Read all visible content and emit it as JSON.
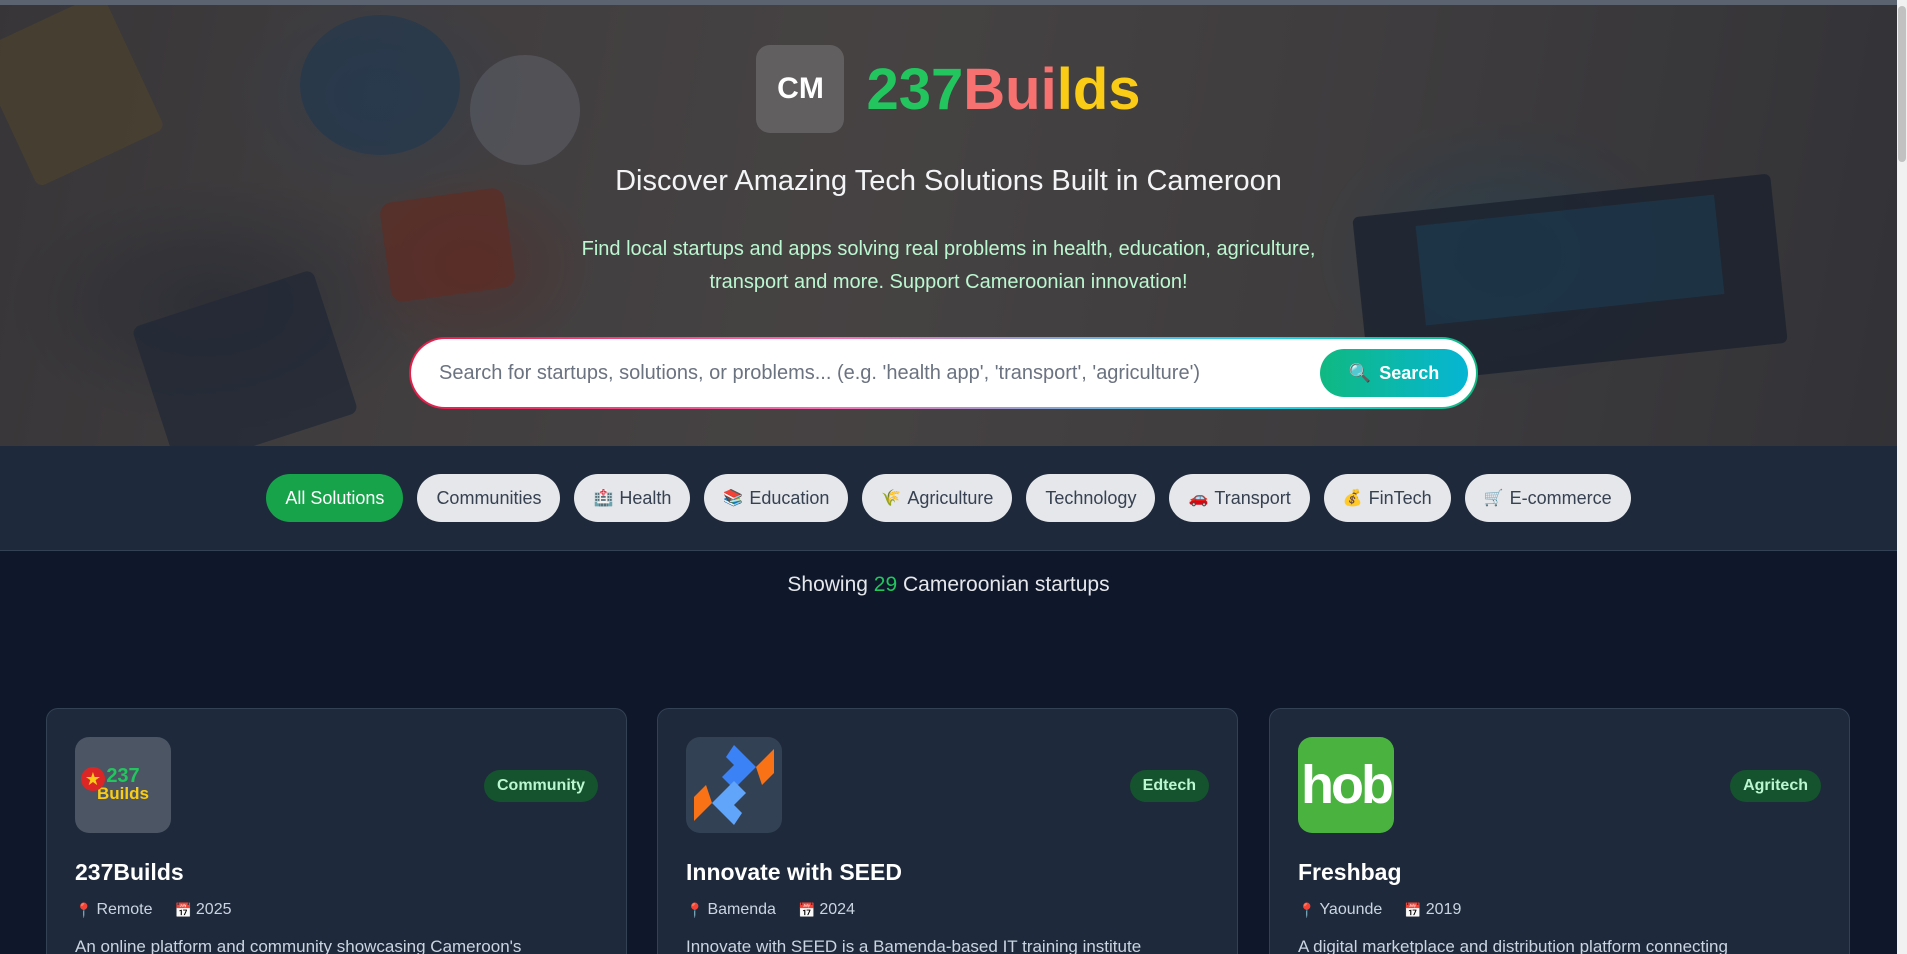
{
  "hero": {
    "logo_badge": "CM",
    "brand_part1": "237",
    "brand_part2": "Bui",
    "brand_part3": "lds",
    "title": "Discover Amazing Tech Solutions Built in Cameroon",
    "subtitle": "Find local startups and apps solving real problems in health, education, agriculture, transport and more. Support Cameroonian innovation!",
    "search_placeholder": "Search for startups, solutions, or problems... (e.g. 'health app', 'transport', 'agriculture')",
    "search_value": "",
    "search_button_label": "Search",
    "search_button_icon": "🔍"
  },
  "filters": [
    {
      "label": "All Solutions",
      "icon": ""
    },
    {
      "label": "Communities",
      "icon": ""
    },
    {
      "label": "Health",
      "icon": "🏥"
    },
    {
      "label": "Education",
      "icon": "📚"
    },
    {
      "label": "Agriculture",
      "icon": "🌾"
    },
    {
      "label": "Technology",
      "icon": ""
    },
    {
      "label": "Transport",
      "icon": "🚗"
    },
    {
      "label": "FinTech",
      "icon": "💰"
    },
    {
      "label": "E-commerce",
      "icon": "🛒"
    }
  ],
  "results": {
    "prefix": "Showing",
    "count": "29",
    "suffix": "Cameroonian startups"
  },
  "cards": [
    {
      "name": "237Builds",
      "badge": "Community",
      "location": "Remote",
      "year": "2025",
      "description": "An online platform and community showcasing Cameroon's",
      "logo_text_top": "237",
      "logo_text_bottom": "Builds"
    },
    {
      "name": "Innovate with SEED",
      "badge": "Edtech",
      "location": "Bamenda",
      "year": "2024",
      "description": "Innovate with SEED is a Bamenda-based IT training institute"
    },
    {
      "name": "Freshbag",
      "badge": "Agritech",
      "location": "Yaounde",
      "year": "2019",
      "description": "A digital marketplace and distribution platform connecting",
      "logo_text": "hob"
    }
  ],
  "colors": {
    "accent_green": "#16a34a",
    "brand_green": "#22c55e",
    "brand_red": "#f87171",
    "brand_yellow": "#facc15",
    "badge_bg": "#14532d"
  }
}
